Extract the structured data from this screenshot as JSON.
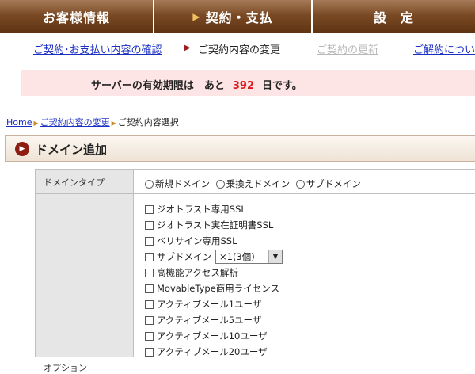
{
  "topnav": {
    "tabs": [
      {
        "label": "お客様情報"
      },
      {
        "label": "契約・支払",
        "marker": "▶"
      },
      {
        "label": "設　定"
      }
    ]
  },
  "subnav": {
    "items": [
      {
        "label": "ご契約･お支払い内容の確認",
        "state": "link"
      },
      {
        "label": "ご契約内容の変更",
        "state": "current",
        "marker": "▶"
      },
      {
        "label": "ご契約の更新",
        "state": "disabled"
      },
      {
        "label": "ご解約につい",
        "state": "link"
      }
    ]
  },
  "notice": {
    "prefix": "サーバーの有効期限は　あと",
    "days": "392",
    "suffix": "日です。"
  },
  "breadcrumb": {
    "home": "Home",
    "parent": "ご契約内容の変更",
    "current": "ご契約内容選択",
    "separator": "▶"
  },
  "section": {
    "title": "ドメイン追加"
  },
  "form": {
    "domain_type": {
      "label": "ドメインタイプ",
      "options": [
        "新規ドメイン",
        "乗換えドメイン",
        "サブドメイン"
      ]
    },
    "options": {
      "label": "オプション",
      "items": [
        "ジオトラスト専用SSL",
        "ジオトラスト実在証明書SSL",
        "ベリサイン専用SSL",
        "サブドメイン",
        "高機能アクセス解析",
        "MovableType商用ライセンス",
        "アクティブメール1ユーザ",
        "アクティブメール5ユーザ",
        "アクティブメール10ユーザ",
        "アクティブメール20ユーザ"
      ],
      "subdomain_select": "×1(3個)"
    }
  },
  "colors": {
    "tab_brown": "#7a4a24",
    "notice_bg": "#fde5e5",
    "days_red": "#e01818",
    "link_blue": "#1a2fc2"
  }
}
